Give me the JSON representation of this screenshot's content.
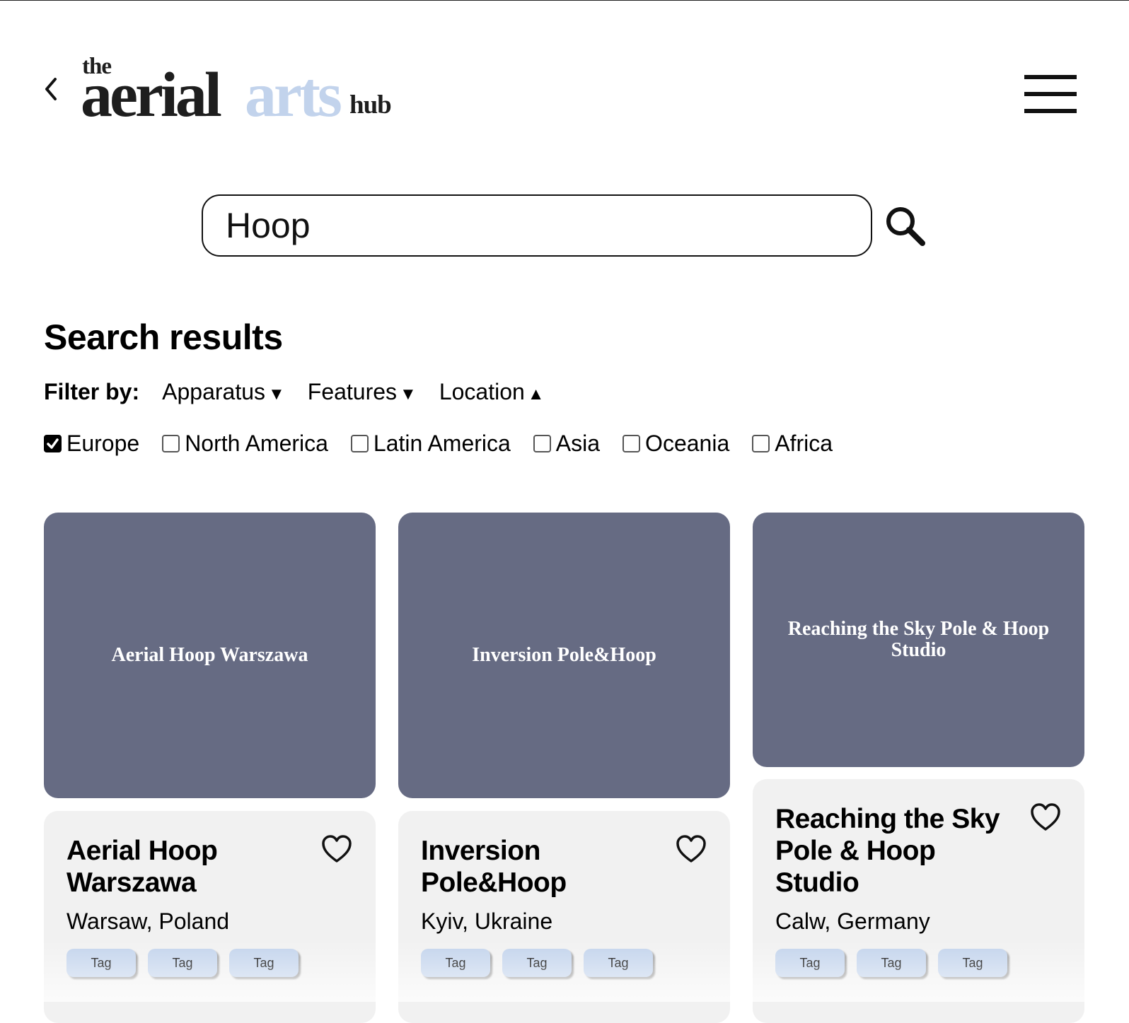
{
  "header": {
    "logo": {
      "the": "the",
      "aerial": "aerial",
      "arts": "arts",
      "hub": "hub"
    }
  },
  "search": {
    "value": "Hoop"
  },
  "results": {
    "title": "Search results",
    "filter_label": "Filter by:",
    "filters": [
      {
        "label": "Apparatus",
        "arrow": "▼"
      },
      {
        "label": "Features",
        "arrow": "▼"
      },
      {
        "label": "Location",
        "arrow": "▲"
      }
    ],
    "regions": [
      {
        "label": "Europe",
        "checked": true
      },
      {
        "label": "North America",
        "checked": false
      },
      {
        "label": "Latin America",
        "checked": false
      },
      {
        "label": "Asia",
        "checked": false
      },
      {
        "label": "Oceania",
        "checked": false
      },
      {
        "label": "Africa",
        "checked": false
      }
    ]
  },
  "cards": [
    {
      "image_text": "Aerial Hoop Warszawa",
      "name": "Aerial Hoop Warszawa",
      "location": "Warsaw, Poland",
      "tags": [
        "Tag",
        "Tag",
        "Tag"
      ]
    },
    {
      "image_text": "Inversion Pole&Hoop",
      "name": "Inversion Pole&Hoop",
      "location": "Kyiv, Ukraine",
      "tags": [
        "Tag",
        "Tag",
        "Tag"
      ]
    },
    {
      "image_text": "Reaching the Sky Pole & Hoop Studio",
      "name": "Reaching the Sky Pole & Hoop Studio",
      "location": "Calw, Germany",
      "tags": [
        "Tag",
        "Tag",
        "Tag"
      ]
    }
  ],
  "colors": {
    "card_image": "#666b83",
    "card_body": "#f1f1f1",
    "tag": "#c2d3ec",
    "logo_accent": "#c2d3ec"
  },
  "icons": {
    "back": "chevron-left-icon",
    "menu": "hamburger-menu-icon",
    "search": "search-icon",
    "favorite": "heart-outline-icon"
  }
}
